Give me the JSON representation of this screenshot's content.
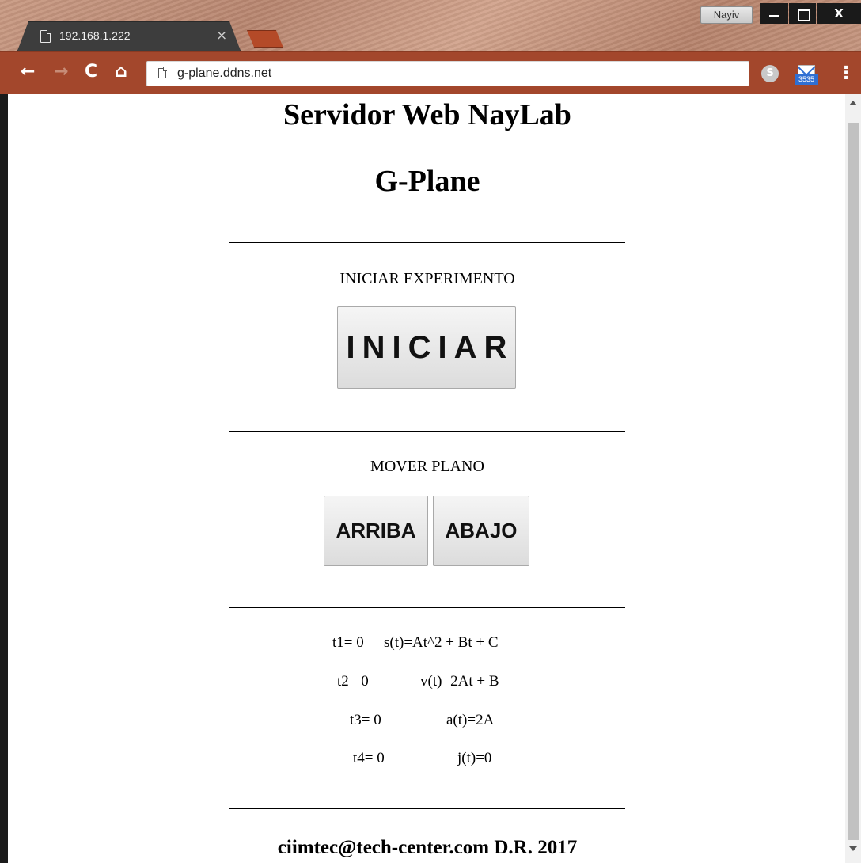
{
  "browser": {
    "tab_title": "192.168.1.222",
    "tab_close": "×",
    "profile_name": "Nayiv",
    "url": "g-plane.ddns.net",
    "mail_badge": "3535",
    "skype_letter": "S",
    "window_close": "X",
    "nav": {
      "back": "←",
      "forward": "→",
      "reload": "C",
      "home": "⌂",
      "menu": "⋮"
    },
    "icons": [
      "page-icon",
      "back-icon",
      "forward-icon",
      "reload-icon",
      "home-icon",
      "skype-icon",
      "mail-icon",
      "menu-icon"
    ],
    "colors": {
      "toolbar": "#a3472c",
      "tab": "#3d3d3d",
      "newtab": "#b44a28"
    }
  },
  "page": {
    "title": "Servidor Web NayLab",
    "subtitle": "G-Plane",
    "divider_text": "",
    "start_section_label": "INICIAR EXPERIMENTO",
    "start_button": "INICIAR",
    "move_section_label": "MOVER PLANO",
    "up_button": "ARRIBA",
    "down_button": "ABAJO",
    "times": [
      {
        "label": "t1= 0",
        "equation": "s(t)=At^2 + Bt + C"
      },
      {
        "label": "t2= 0",
        "equation": "v(t)=2At + B"
      },
      {
        "label": "t3= 0",
        "equation": "a(t)=2A"
      },
      {
        "label": "t4= 0",
        "equation": "j(t)=0"
      }
    ],
    "footer": "ciimtec@tech-center.com D.R. 2017"
  }
}
